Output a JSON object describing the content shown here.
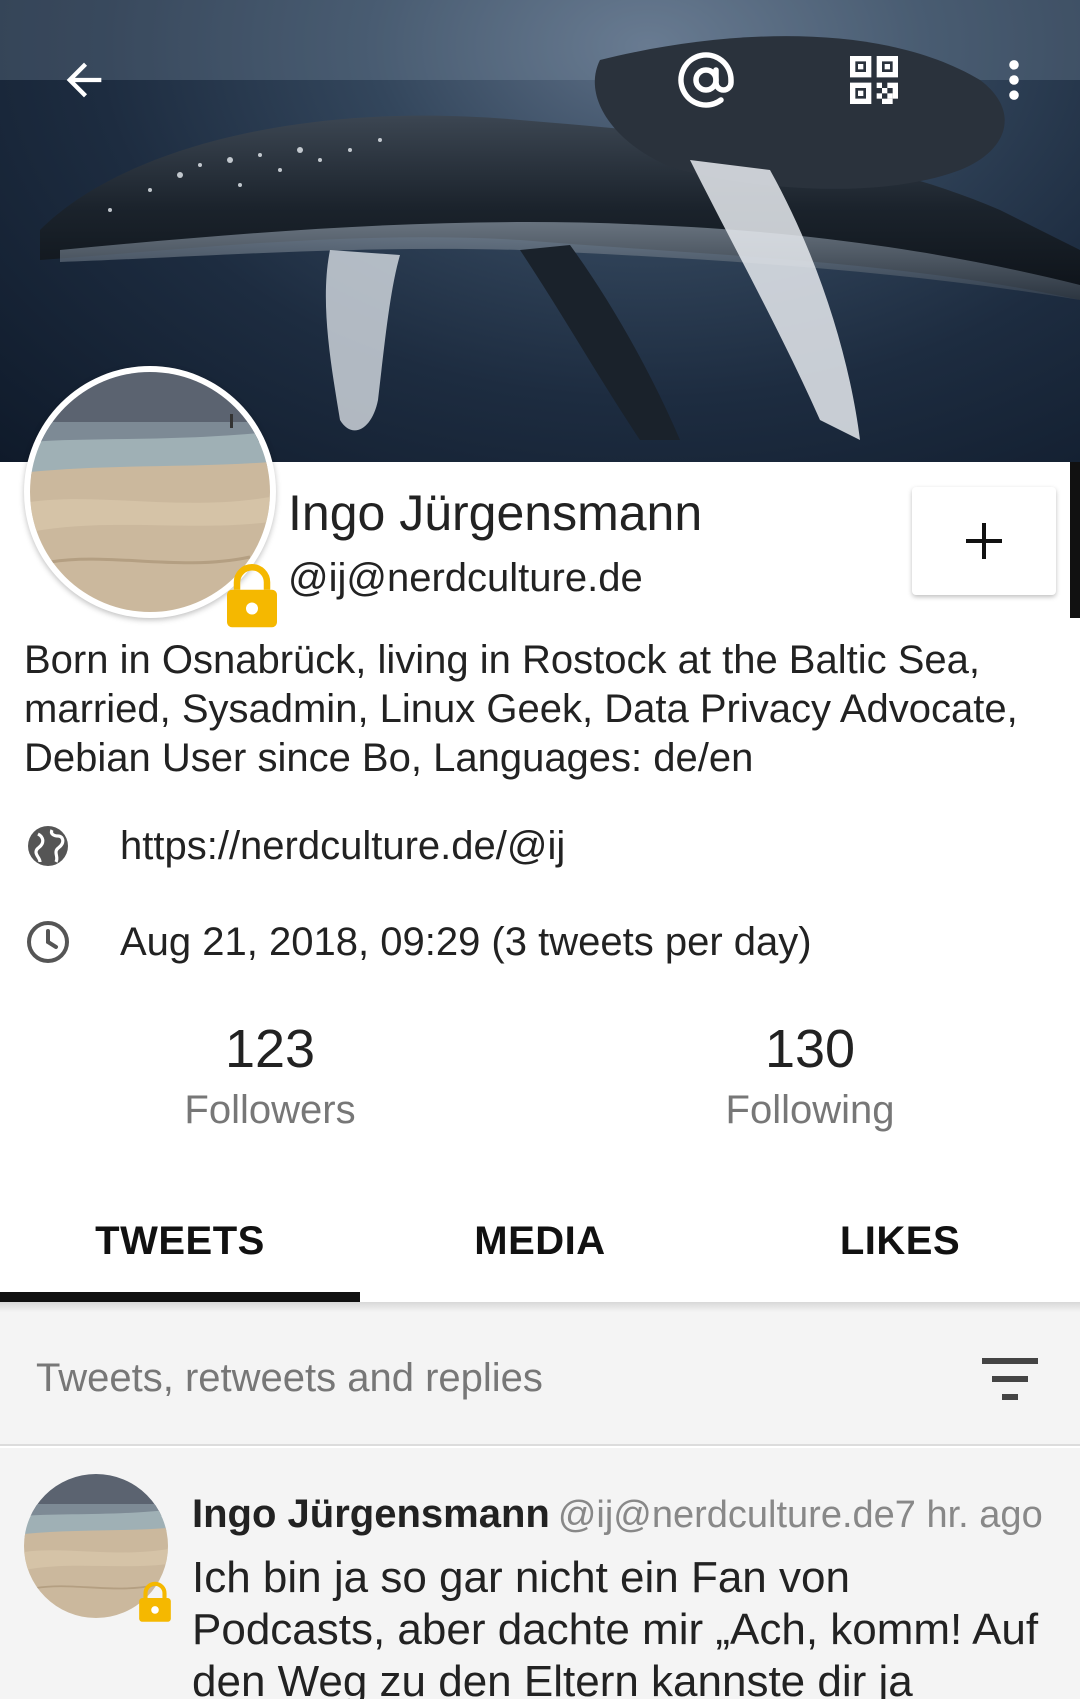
{
  "topbar": {
    "back_icon": "arrow-left-icon",
    "mention_icon": "at-sign-icon",
    "qr_icon": "qr-code-icon",
    "menu_icon": "more-vert-icon"
  },
  "profile": {
    "name": "Ingo Jürgensmann",
    "handle": "@ij@nerdculture.de",
    "bio": "Born in Osnabrück, living in Rostock at the Baltic Sea, married, Sysadmin, Linux Geek, Data Privacy Advocate, Debian User since Bo, Languages: de/en",
    "website": "https://nerdculture.de/@ij",
    "joined": "Aug 21, 2018, 09:29 (3 tweets per day)",
    "locked": true,
    "follow_icon": "plus-icon"
  },
  "stats": {
    "followers_count": "123",
    "followers_label": "Followers",
    "following_count": "130",
    "following_label": "Following"
  },
  "tabs": [
    {
      "label": "TWEETS",
      "active": true
    },
    {
      "label": "MEDIA",
      "active": false
    },
    {
      "label": "LIKES",
      "active": false
    }
  ],
  "filter": {
    "label": "Tweets, retweets and replies",
    "icon": "filter-icon"
  },
  "tweet": {
    "author": "Ingo Jürgensmann",
    "handle": "@ij@nerdculture.de",
    "time": "7 hr. ago",
    "text": "Ich bin ja so gar nicht ein Fan von Podcasts, aber dachte mir „Ach, komm! Auf den Weg zu den Eltern kannste dir ja"
  },
  "colors": {
    "lock": "#f5b800",
    "tab_indicator": "#111111",
    "muted": "#777777"
  }
}
